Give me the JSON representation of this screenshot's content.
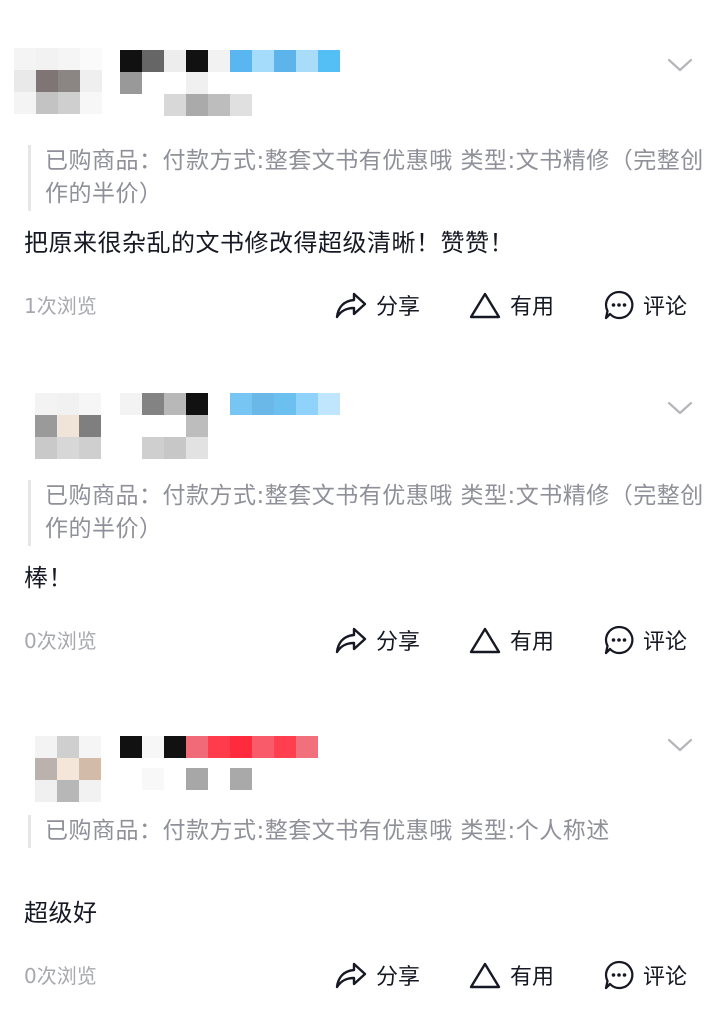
{
  "reviews": [
    {
      "product_label": "已购商品：付款方式:整套文书有优惠哦 类型:文书精修（完整创作的半价）",
      "content": "把原来很杂乱的文书修改得超级清晰！赞赞！",
      "views": "1次浏览",
      "actions": {
        "share": "分享",
        "useful": "有用",
        "comment": "评论"
      }
    },
    {
      "product_label": "已购商品：付款方式:整套文书有优惠哦 类型:文书精修（完整创作的半价）",
      "content": "棒！",
      "views": "0次浏览",
      "actions": {
        "share": "分享",
        "useful": "有用",
        "comment": "评论"
      }
    },
    {
      "product_label": "已购商品：付款方式:整套文书有优惠哦 类型:个人称述",
      "content": "超级好",
      "views": "0次浏览",
      "actions": {
        "share": "分享",
        "useful": "有用",
        "comment": "评论"
      }
    }
  ],
  "colors": {
    "primary_text": "#161823",
    "secondary_text": "#8f9099",
    "muted_text": "#a7a8ae",
    "divider": "#e6e6e9"
  },
  "icons": [
    "chevron-down-icon",
    "share-icon",
    "useful-icon",
    "comment-icon"
  ]
}
